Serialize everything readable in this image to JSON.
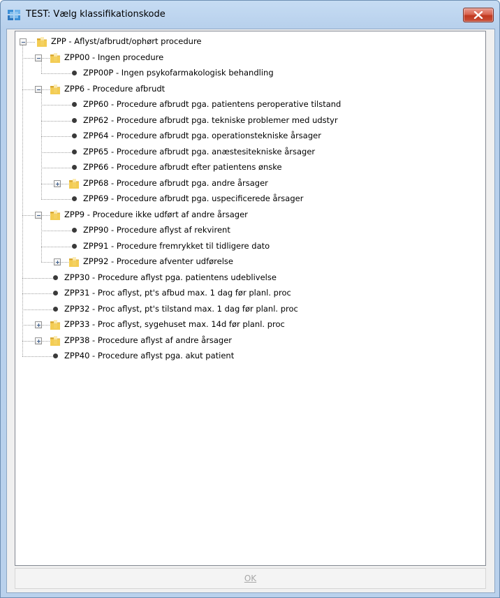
{
  "window": {
    "title": "TEST: Vælg klassifikationskode",
    "close_icon": "close-icon"
  },
  "tree": {
    "nodes": [
      {
        "label": "ZPP - Aflyst/afbrudt/ophørt procedure",
        "level": 0,
        "type": "folder",
        "expander": "collapse"
      },
      {
        "label": "ZPP00 - Ingen procedure",
        "level": 1,
        "type": "folder",
        "expander": "collapse"
      },
      {
        "label": "ZPP00P - Ingen psykofarmakologisk behandling",
        "level": 2,
        "type": "leaf"
      },
      {
        "label": "ZPP6 - Procedure afbrudt",
        "level": 1,
        "type": "folder",
        "expander": "collapse"
      },
      {
        "label": "ZPP60 - Procedure afbrudt pga. patientens peroperative tilstand",
        "level": 2,
        "type": "leaf"
      },
      {
        "label": "ZPP62 - Procedure afbrudt pga. tekniske problemer med udstyr",
        "level": 2,
        "type": "leaf"
      },
      {
        "label": "ZPP64 - Procedure afbrudt pga. operationstekniske årsager",
        "level": 2,
        "type": "leaf"
      },
      {
        "label": "ZPP65 - Procedure afbrudt pga. anæstesitekniske årsager",
        "level": 2,
        "type": "leaf"
      },
      {
        "label": "ZPP66 - Procedure afbrudt efter patientens ønske",
        "level": 2,
        "type": "leaf"
      },
      {
        "label": "ZPP68 - Procedure afbrudt pga. andre årsager",
        "level": 2,
        "type": "folder",
        "expander": "expand"
      },
      {
        "label": "ZPP69 - Procedure afbrudt pga. uspecificerede årsager",
        "level": 2,
        "type": "leaf"
      },
      {
        "label": "ZPP9 - Procedure ikke udført af andre årsager",
        "level": 1,
        "type": "folder",
        "expander": "collapse"
      },
      {
        "label": "ZPP90 - Procedure aflyst af rekvirent",
        "level": 2,
        "type": "leaf"
      },
      {
        "label": "ZPP91 - Procedure fremrykket til tidligere dato",
        "level": 2,
        "type": "leaf"
      },
      {
        "label": "ZPP92 - Procedure afventer udførelse",
        "level": 2,
        "type": "folder",
        "expander": "expand"
      },
      {
        "label": "ZPP30 - Procedure aflyst pga. patientens udeblivelse",
        "level": 1,
        "type": "leaf"
      },
      {
        "label": "ZPP31 - Proc aflyst, pt's afbud max. 1 dag før planl. proc",
        "level": 1,
        "type": "leaf"
      },
      {
        "label": "ZPP32 - Proc aflyst, pt's tilstand max. 1 dag før planl. proc",
        "level": 1,
        "type": "leaf"
      },
      {
        "label": "ZPP33 - Proc aflyst, sygehuset max. 14d før planl. proc",
        "level": 1,
        "type": "folder",
        "expander": "expand"
      },
      {
        "label": "ZPP38 - Procedure aflyst af andre årsager",
        "level": 1,
        "type": "folder",
        "expander": "expand"
      },
      {
        "label": "ZPP40 - Procedure aflyst pga. akut patient",
        "level": 1,
        "type": "leaf"
      }
    ]
  },
  "footer": {
    "ok_label": "OK",
    "ok_enabled": false
  },
  "colors": {
    "window_frame": "#b9d1ec",
    "close_button": "#c9513a",
    "folder": "#f2c94c",
    "disabled_text": "#a8a8a8"
  }
}
